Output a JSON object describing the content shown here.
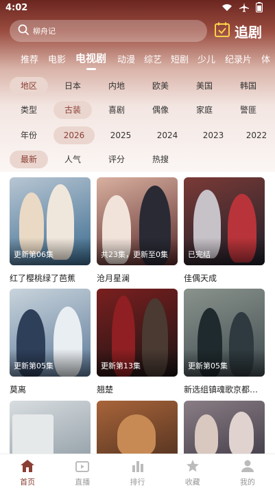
{
  "status": {
    "time": "4:02"
  },
  "search": {
    "placeholder": "柳舟记"
  },
  "brand": {
    "label": "追剧"
  },
  "tabs": [
    "推荐",
    "电影",
    "电视剧",
    "动漫",
    "综艺",
    "短剧",
    "少儿",
    "纪录片",
    "体"
  ],
  "active_tab": "电视剧",
  "filters": {
    "region": [
      "地区",
      "日本",
      "内地",
      "欧美",
      "美国",
      "韩国"
    ],
    "type": [
      "类型",
      "古装",
      "喜剧",
      "偶像",
      "家庭",
      "警匪"
    ],
    "year": [
      "年份",
      "2026",
      "2025",
      "2024",
      "2023",
      "2022"
    ],
    "sort": [
      "最新",
      "人气",
      "评分",
      "热搜"
    ]
  },
  "items": [
    {
      "title": "红了樱桃绿了芭蕉",
      "badge": "更新第06集",
      "colors": [
        "#3b6b8f",
        "#b8c6d3"
      ]
    },
    {
      "title": "沧月星澜",
      "badge": "共23集，更新至0集",
      "colors": [
        "#5a2a2a",
        "#d9b0a0"
      ]
    },
    {
      "title": "佳偶天成",
      "badge": "已完结",
      "colors": [
        "#1d1f2a",
        "#7a3a36"
      ]
    },
    {
      "title": "莫离",
      "badge": "更新第05集",
      "colors": [
        "#5d7a9a",
        "#c9d4dc"
      ]
    },
    {
      "title": "翘楚",
      "badge": "更新第13集",
      "colors": [
        "#1b1414",
        "#7a1f1f"
      ]
    },
    {
      "title": "新选组镇魂歌京都决...",
      "badge": "更新第05集",
      "colors": [
        "#3e4a4f",
        "#8a938c"
      ]
    },
    {
      "title": "",
      "badge": "",
      "colors": [
        "#7f8d97",
        "#d8dde0"
      ]
    },
    {
      "title": "",
      "badge": "",
      "colors": [
        "#3a2418",
        "#a8643a"
      ]
    },
    {
      "title": "",
      "badge": "",
      "colors": [
        "#2c2a36",
        "#8a7d85"
      ]
    }
  ],
  "nav": [
    {
      "label": "首页",
      "icon": "home-icon",
      "active": true
    },
    {
      "label": "直播",
      "icon": "tv-play-icon",
      "active": false
    },
    {
      "label": "排行",
      "icon": "ranking-icon",
      "active": false
    },
    {
      "label": "收藏",
      "icon": "star-icon",
      "active": false
    },
    {
      "label": "我的",
      "icon": "user-icon",
      "active": false
    }
  ],
  "colors": {
    "accent": "#8a3f35",
    "chip_bg": "#ead6cf"
  }
}
